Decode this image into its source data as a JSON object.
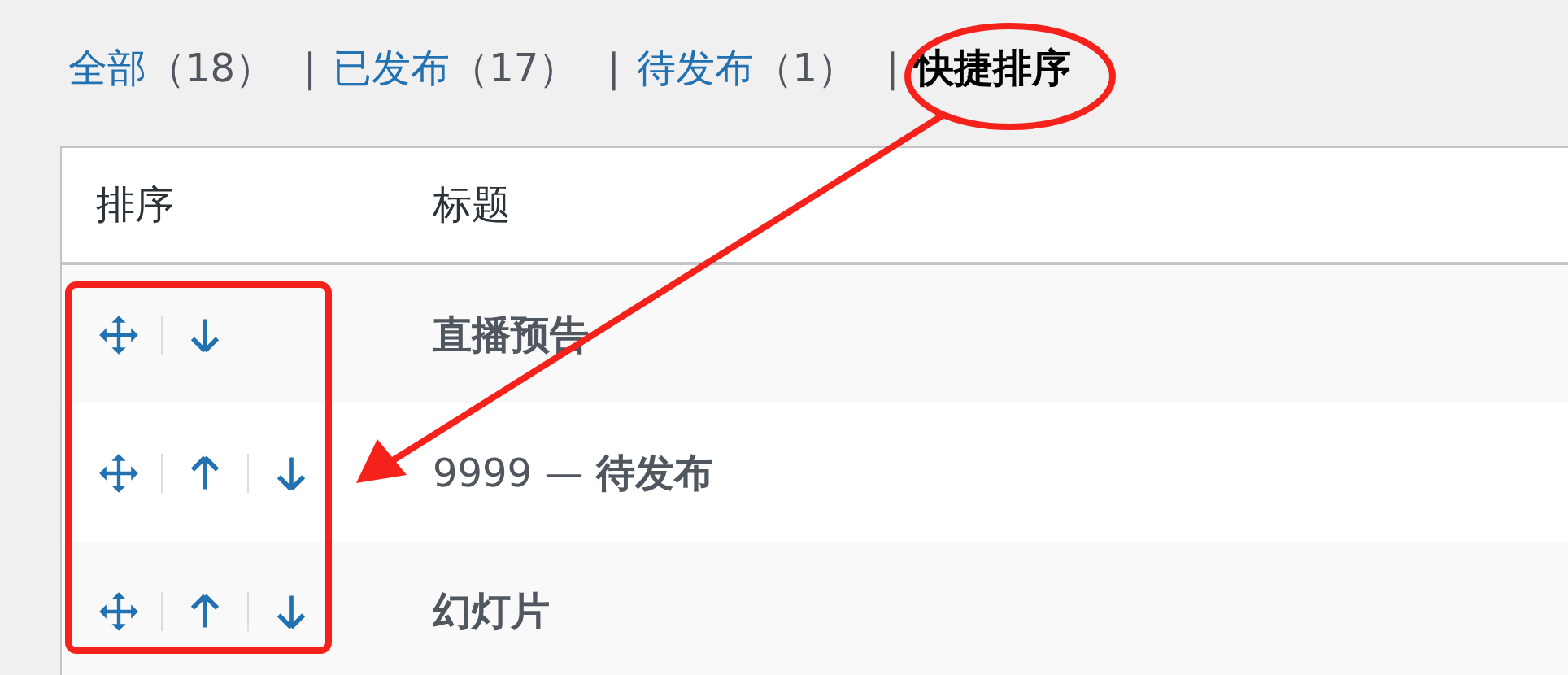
{
  "filters": [
    {
      "label": "全部",
      "count": "（18）",
      "selected": false
    },
    {
      "separator": "|",
      "label": "已发布",
      "count": "（17）",
      "selected": false
    },
    {
      "separator": "|",
      "label": "待发布",
      "count": "（1）",
      "selected": false
    },
    {
      "separator": "|",
      "label": "快捷排序",
      "selected": true
    }
  ],
  "table": {
    "columns": [
      "排序",
      "标题"
    ],
    "rows": [
      {
        "title": "直播预告",
        "actions": [
          {
            "kind": "move"
          },
          {
            "kind": "down"
          }
        ]
      },
      {
        "title": "9999 — **待发布**",
        "actions": [
          {
            "kind": "move"
          },
          {
            "kind": "up"
          },
          {
            "kind": "down"
          }
        ]
      },
      {
        "title": "幻灯片",
        "actions": [
          {
            "kind": "move"
          },
          {
            "kind": "up"
          },
          {
            "kind": "down"
          }
        ]
      }
    ]
  },
  "annotations": [
    {
      "kind": "ellipse"
    },
    {
      "kind": "arrow"
    },
    {
      "kind": "rectangle"
    }
  ]
}
